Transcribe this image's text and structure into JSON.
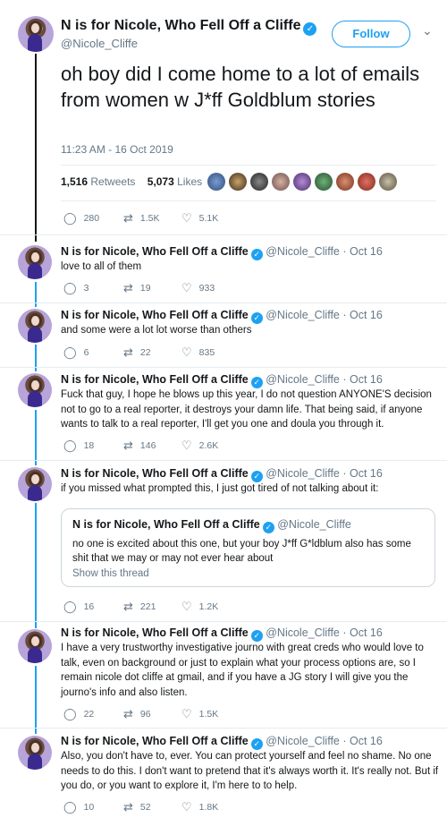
{
  "main_tweet": {
    "name": "N is for Nicole, Who Fell Off a Cliffe",
    "handle": "@Nicole_Cliffe",
    "follow_label": "Follow",
    "text": "oh boy did I come home to a lot of emails from women w J*ff Goldblum stories",
    "timestamp": "11:23 AM - 16 Oct 2019",
    "retweets_count": "1,516",
    "retweets_label": "Retweets",
    "likes_count": "5,073",
    "likes_label": "Likes",
    "actions": {
      "replies": "280",
      "retweets": "1.5K",
      "likes": "5.1K"
    }
  },
  "replies": [
    {
      "name": "N is for Nicole, Who Fell Off a Cliffe",
      "meta": "@Nicole_Cliffe · Oct 16",
      "text": "love to all of them",
      "replies": "3",
      "retweets": "19",
      "likes": "933"
    },
    {
      "name": "N is for Nicole, Who Fell Off a Cliffe",
      "meta": "@Nicole_Cliffe · Oct 16",
      "text": "and some were a lot lot worse than others",
      "replies": "6",
      "retweets": "22",
      "likes": "835"
    },
    {
      "name": "N is for Nicole, Who Fell Off a Cliffe",
      "meta": "@Nicole_Cliffe · Oct 16",
      "text": "Fuck that guy, I hope he blows up this year, I do not question ANYONE'S decision not to go to a real reporter, it destroys your damn life. That being said, if anyone wants to talk to a real reporter, I'll get you one and doula you through it.",
      "replies": "18",
      "retweets": "146",
      "likes": "2.6K"
    },
    {
      "name": "N is for Nicole, Who Fell Off a Cliffe",
      "meta": "@Nicole_Cliffe · Oct 16",
      "text": "if you missed what prompted this, I just got tired of not talking about it:",
      "replies": "16",
      "retweets": "221",
      "likes": "1.2K"
    },
    {
      "name": "N is for Nicole, Who Fell Off a Cliffe",
      "meta": "@Nicole_Cliffe · Oct 16",
      "text": "I have a very trustworthy investigative journo with great creds who would love to talk, even on background or just to explain what your process options are, so I remain nicole dot cliffe at gmail, and if you have a JG story I will give you the journo's info and also listen.",
      "replies": "22",
      "retweets": "96",
      "likes": "1.5K"
    },
    {
      "name": "N is for Nicole, Who Fell Off a Cliffe",
      "meta": "@Nicole_Cliffe · Oct 16",
      "text": "Also, you don't have to, ever. You can protect yourself and feel no shame. No one needs to do this. I don't want to pretend that it's always worth it. It's really not. But if you do, or you want to explore it, I'm here to to help.",
      "replies": "10",
      "retweets": "52",
      "likes": "1.8K"
    }
  ],
  "quoted_tweet": {
    "name": "N is for Nicole, Who Fell Off a Cliffe",
    "handle": "@Nicole_Cliffe",
    "text": "no one is excited about this one, but your boy J*ff G*ldblum also has some shit that we may or may not ever hear about",
    "show_thread": "Show this thread"
  },
  "icons": {
    "reply": "reply-icon",
    "retweet": "retweet-icon",
    "like": "heart-icon",
    "verified": "verified-icon",
    "more": "chevron-down-icon"
  },
  "colors": {
    "accent": "#1da1f2",
    "text": "#14171a",
    "muted": "#657786",
    "border": "#e6ecf0"
  }
}
